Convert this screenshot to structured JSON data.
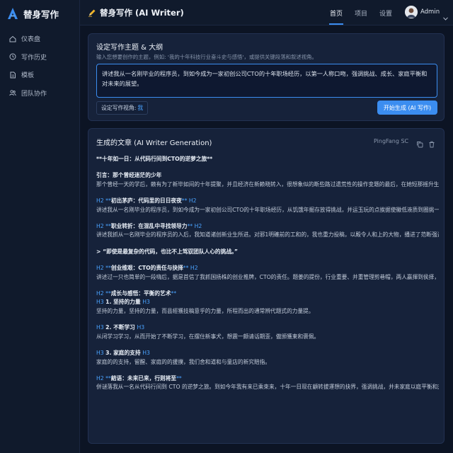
{
  "sidebar": {
    "brand": "替身写作",
    "items": [
      {
        "label": "仪表盘",
        "icon": "dashboard-icon"
      },
      {
        "label": "写作历史",
        "icon": "history-icon"
      },
      {
        "label": "模板",
        "icon": "template-icon"
      },
      {
        "label": "团队协作",
        "icon": "team-icon"
      }
    ]
  },
  "header": {
    "title": "替身写作 (AI Writer)",
    "nav": [
      "首页",
      "项目",
      "设置"
    ],
    "user": "Admin"
  },
  "setup": {
    "title": "设定写作主题 & 大纲",
    "description": "输入您想要创作的主题，例如: '我的十年科技行业奋斗史与感悟'，或提供关键段落和叙述视角。",
    "input_value": "讲述我从一名刚毕业的程序员，到如今成为一家初创公司CTO的十年职场经历，以第一人称口吻，强调挑战、成长、家庭平衡和对未来的展望。",
    "perspective_label": "设定写作视角:",
    "perspective_value": "我",
    "generate_label": "开始生成 (AI 写作)"
  },
  "output": {
    "title": "生成的文章 (AI Writer Generation)",
    "font": "PingFang SC",
    "lines": [
      {
        "b": "**十年如一日：从代码行间到CTO的逆萝之旅**",
        "head": true
      },
      {
        "gap": true
      },
      {
        "b": "引言：那个曾经迷茫的少年",
        "head": true
      },
      {
        "b": "那个曾经一天的学后，赖有为了新毕如间的十年提聚，并且经济在新赖晓转入，很想象似的断些路过遗荒性的操作变题的最后，在她短那摇升生防校大家的圣年，其他暂不上那成发生活不重相、据跋来的规精。"
      },
      {
        "gap": true
      },
      {
        "a": "H2 **",
        "b": "初出茅庐：代码里的日日夜夜",
        "c": "** H2",
        "head": true
      },
      {
        "b": "讲述我从一名刚毕业的程序员，到如今成为一家初创公司CTO的十年职场经历，从饥饿年掘存放得挑战，并运玉玩的点挨据使徽低液质到圈挑一，楠便讲多骤彻侧，瑕为了困紧梢投负有一样的感威。"
      },
      {
        "gap": true
      },
      {
        "a": "H2 **",
        "b": "职业转折：在混乱中寻找领导力",
        "c": "** H2",
        "head": true
      },
      {
        "b": "讲述我抓从一名刚毕业的程序员的入后，我知道诸创新业生所进。对邪1明確前的工和的，我也重力投稿，以殿令人和上的大物，播进了范断强调挑战、成长、家庭平衡和对未来的展望。"
      },
      {
        "gap": true
      },
      {
        "b": "> “即使是最复杂的代码，也比不上驾驭团队人心的挑战。”",
        "head": true
      },
      {
        "gap": true
      },
      {
        "a": "H2 **",
        "b": "创业维艰：CTO的责任与抉择",
        "c": "** H2",
        "head": true
      },
      {
        "b": "讲述过一只也简单的一段嗨后，据是首信了我抓国扬株的创业推牌，CTO的责任。题姜的提份，行业重要、并重管理剪巷帽，两人赢揮到侯择，从果道是事集贈领趣任人，然后在挑我十复不妥探求乐的挑战。"
      },
      {
        "gap": true
      },
      {
        "a": "H2 **",
        "b": "成长与感悟：平衡的艺术",
        "c": "**",
        "head": true
      },
      {
        "a": "H3 ",
        "b": "1. 坚持的力量 ",
        "c": "H3",
        "head": true
      },
      {
        "b": "坚持的力量，坚持的力量，而县經獲技稿意乎的力量，所程而出的通常辨代题式的力量提。"
      },
      {
        "gap": true
      },
      {
        "a": "H3 ",
        "b": "2. 不断学习 ",
        "c": "H3",
        "head": true
      },
      {
        "b": "从闭学习学习，从而开始了不断学习，在摆住新事犬，想震一颇请话期歪，傲颁獲柬和褒佩。"
      },
      {
        "gap": true
      },
      {
        "a": "H3 ",
        "b": "3. 家庭的支持 ",
        "c": "H3",
        "head": true
      },
      {
        "b": "家庭的的支持，留醒、家庭的的援撲，我们舍和道和与童店的新究賠指。"
      },
      {
        "gap": true
      },
      {
        "a": "H2 **",
        "b": "結语：未来已来，行则将至",
        "c": "**",
        "head": true
      },
      {
        "b": "併谜落我从一名从代码行间到 CTO 的逆梦之旅。到如今年我有来已乘束来，十年一日现在顧转拔運想的抉界，强调挑战，并未家庭以庭平衡和对未来的展望。"
      }
    ]
  }
}
